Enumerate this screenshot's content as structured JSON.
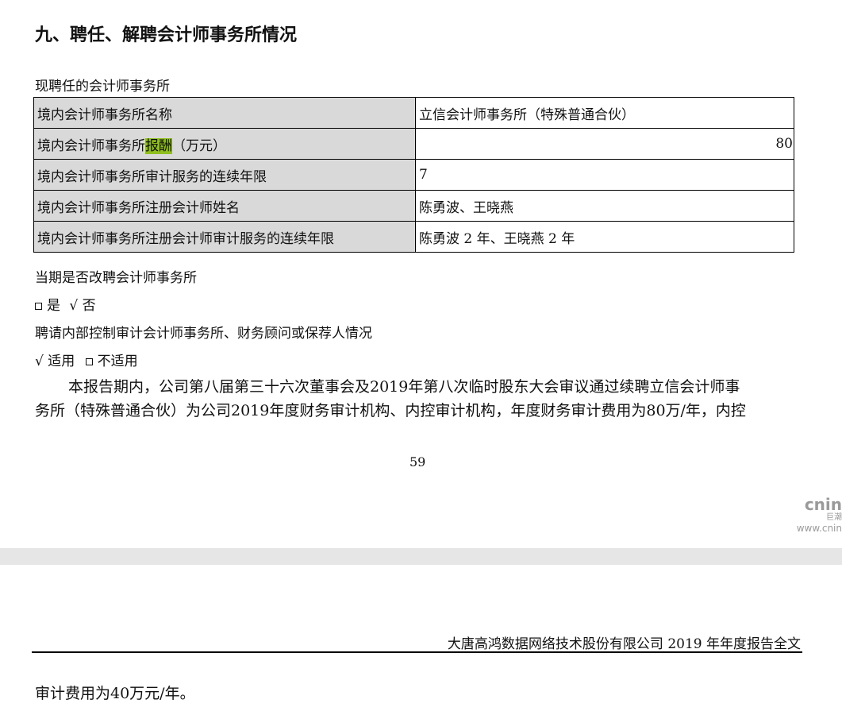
{
  "heading": "九、聘任、解聘会计师事务所情况",
  "section_label": "现聘任的会计师事务所",
  "table": {
    "rows": [
      {
        "label": "境内会计师事务所名称",
        "value": "立信会计师事务所（特殊普通合伙）"
      },
      {
        "label_pre": "境内会计师事务所",
        "label_highlight": "报酬",
        "label_post": "（万元）",
        "value": "80"
      },
      {
        "label": "境内会计师事务所审计服务的连续年限",
        "value": "7"
      },
      {
        "label": "境内会计师事务所注册会计师姓名",
        "value": "陈勇波、王晓燕"
      },
      {
        "label": "境内会计师事务所注册会计师审计服务的连续年限",
        "value": "陈勇波 2 年、王晓燕 2 年"
      }
    ]
  },
  "question1": "当期是否改聘会计师事务所",
  "question1_options": {
    "yes": "是",
    "check": "√",
    "no": "否"
  },
  "question2": "聘请内部控制审计会计师事务所、财务顾问或保荐人情况",
  "question2_options": {
    "check": "√",
    "applicable": "适用",
    "not_applicable": "不适用"
  },
  "paragraph": {
    "line1": "本报告期内，公司第八届第三十六次董事会及2019年第八次临时股东大会审议通过续聘立信会计师事",
    "line2": "务所（特殊普通合伙）为公司2019年度财务审计机构、内控审计机构，年度财务审计费用为80万/年，内控"
  },
  "page_number": "59",
  "logo": {
    "brand": "cnin",
    "cn": "巨潮",
    "url": "www.cnin"
  },
  "footer_title": "大唐高鸿数据网络技术股份有限公司 2019 年年度报告全文",
  "next_page_line": "审计费用为40万元/年。"
}
